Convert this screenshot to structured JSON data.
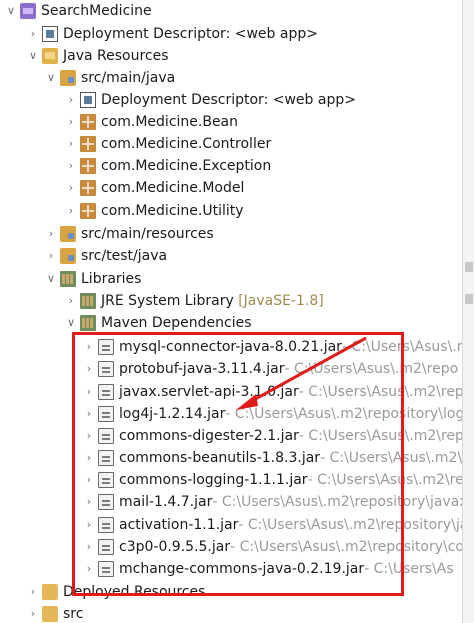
{
  "tree": {
    "project": "SearchMedicine",
    "deployment_descriptor": "Deployment Descriptor: <web app>",
    "java_resources": "Java Resources",
    "src_main_java": "src/main/java",
    "dd_inner": "Deployment Descriptor: <web app>",
    "packages": [
      "com.Medicine.Bean",
      "com.Medicine.Controller",
      "com.Medicine.Exception",
      "com.Medicine.Model",
      "com.Medicine.Utility"
    ],
    "src_main_resources": "src/main/resources",
    "src_test_java": "src/test/java",
    "libraries": "Libraries",
    "jre_label": "JRE System Library",
    "jre_version": "[JavaSE-1.8]",
    "maven": "Maven Dependencies",
    "jars": [
      {
        "name": "mysql-connector-java-8.0.21.jar",
        "path": " - C:\\Users\\Asus\\.m"
      },
      {
        "name": "protobuf-java-3.11.4.jar",
        "path": " - C:\\Users\\Asus\\.m2\\repo"
      },
      {
        "name": "javax.servlet-api-3.1.0.jar",
        "path": " - C:\\Users\\Asus\\.m2\\repo"
      },
      {
        "name": "log4j-1.2.14.jar",
        "path": " - C:\\Users\\Asus\\.m2\\repository\\log"
      },
      {
        "name": "commons-digester-2.1.jar",
        "path": " - C:\\Users\\Asus\\.m2\\rep"
      },
      {
        "name": "commons-beanutils-1.8.3.jar",
        "path": " - C:\\Users\\Asus\\.m2\\r"
      },
      {
        "name": "commons-logging-1.1.1.jar",
        "path": " - C:\\Users\\Asus\\.m2\\re"
      },
      {
        "name": "mail-1.4.7.jar",
        "path": " - C:\\Users\\Asus\\.m2\\repository\\javax"
      },
      {
        "name": "activation-1.1.jar",
        "path": " - C:\\Users\\Asus\\.m2\\repository\\ja"
      },
      {
        "name": "c3p0-0.9.5.5.jar",
        "path": " - C:\\Users\\Asus\\.m2\\repository\\co"
      },
      {
        "name": "mchange-commons-java-0.2.19.jar",
        "path": " - C:\\Users\\As"
      }
    ],
    "deployed_resources": "Deployed Resources",
    "src": "src"
  },
  "colors": {
    "highlight_box": "#e11a1a",
    "arrow": "#e11a1a",
    "decoration": "#9a9a9a"
  }
}
